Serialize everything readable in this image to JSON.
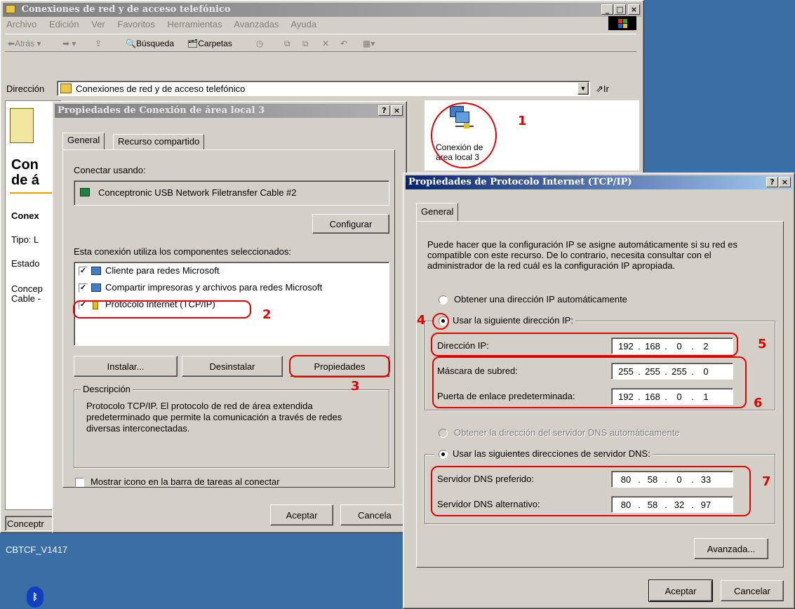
{
  "explorer": {
    "title": "Conexiones de red y de acceso telefónico",
    "menu": [
      "Archivo",
      "Edición",
      "Ver",
      "Favoritos",
      "Herramientas",
      "Avanzadas",
      "Ayuda"
    ],
    "toolbar": {
      "back": "Atrás",
      "search": "Búsqueda",
      "folders": "Carpetas"
    },
    "address_label": "Dirección",
    "address_value": "Conexiones de red y de acceso telefónico",
    "go_label": "Ir",
    "left_pane": {
      "heading1": "Con",
      "heading2": "de á",
      "item1": "Conex",
      "item2": "Tipo: L",
      "item3": "Estado",
      "item4a": "Concep",
      "item4b": "Cable -"
    },
    "status": "Conceptr",
    "connection_icon_label": "Conexión de área local 3"
  },
  "desktop": {
    "label": "CBTCF_V1417"
  },
  "lan_dialog": {
    "title": "Propiedades de Conexión de área local 3",
    "tabs": [
      "General",
      "Recurso compartido"
    ],
    "connect_using_label": "Conectar usando:",
    "adapter": "Conceptronic USB Network Filetransfer Cable #2",
    "configure_button": "Configurar",
    "components_label": "Esta conexión utiliza los componentes seleccionados:",
    "components": [
      "Cliente para redes Microsoft",
      "Compartir impresoras y archivos para redes Microsoft",
      "Protocolo Internet (TCP/IP)"
    ],
    "install_button": "Instalar...",
    "uninstall_button": "Desinstalar",
    "properties_button": "Propiedades",
    "description_legend": "Descripción",
    "description_text": "Protocolo TCP/IP. El protocolo de red de área extendida predeterminado que permite la comunicación a través de redes diversas interconectadas.",
    "show_icon_label": "Mostrar icono en la barra de tareas al conectar",
    "ok_button": "Aceptar",
    "cancel_button": "Cancela"
  },
  "tcp_dialog": {
    "title": "Propiedades de Protocolo Internet (TCP/IP)",
    "tab": "General",
    "intro": "Puede hacer que la configuración IP se asigne automáticamente si su red es compatible con este recurso. De lo contrario, necesita consultar con el administrador de la red cuál es la configuración IP apropiada.",
    "auto_ip": "Obtener una dirección IP automáticamente",
    "use_ip": "Usar la siguiente dirección IP:",
    "ip_label": "Dirección IP:",
    "ip_value": [
      "192",
      "168",
      "0",
      "2"
    ],
    "mask_label": "Máscara de subred:",
    "mask_value": [
      "255",
      "255",
      "255",
      "0"
    ],
    "gateway_label": "Puerta de enlace predeterminada:",
    "gateway_value": [
      "192",
      "168",
      "0",
      "1"
    ],
    "auto_dns": "Obtener la dirección del servidor DNS automáticamente",
    "use_dns": "Usar las siguientes direcciones de servidor DNS:",
    "dns1_label": "Servidor DNS preferido:",
    "dns1_value": [
      "80",
      "58",
      "0",
      "33"
    ],
    "dns2_label": "Servidor DNS alternativo:",
    "dns2_value": [
      "80",
      "58",
      "32",
      "97"
    ],
    "advanced_button": "Avanzada...",
    "ok_button": "Aceptar",
    "cancel_button": "Cancelar"
  },
  "annotations": [
    "1",
    "2",
    "3",
    "4",
    "5",
    "6",
    "7"
  ],
  "colors": {
    "annotation": "#e00000",
    "title_active": "#0a246a",
    "desktop": "#3a6ea5"
  }
}
